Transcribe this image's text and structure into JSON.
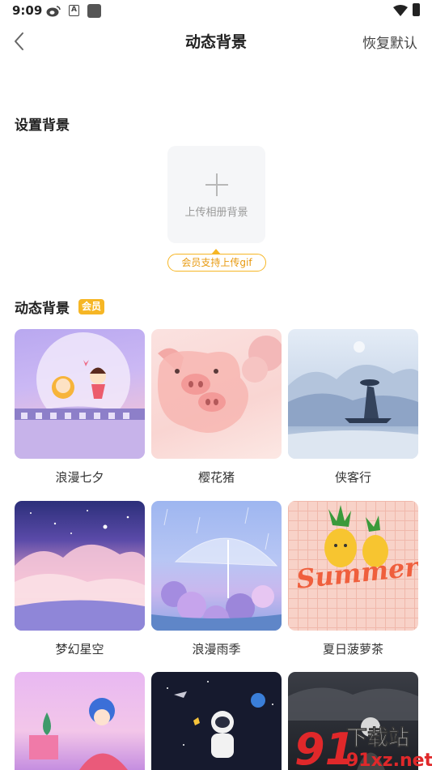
{
  "status_bar": {
    "time": "9:09",
    "icons": [
      "weibo-icon",
      "a-icon",
      "square-icon",
      "wifi-icon",
      "battery-icon"
    ]
  },
  "header": {
    "title": "动态背景",
    "restore_label": "恢复默认",
    "back_icon": "chevron-left-icon"
  },
  "set_background": {
    "title": "设置背景",
    "upload_label": "上传相册背景",
    "gif_tip": "会员支持上传gif"
  },
  "dynamic_backgrounds": {
    "title": "动态背景",
    "vip_badge": "会员",
    "items": [
      {
        "label": "浪漫七夕"
      },
      {
        "label": "樱花猪"
      },
      {
        "label": "侠客行"
      },
      {
        "label": "梦幻星空"
      },
      {
        "label": "浪漫雨季"
      },
      {
        "label": "夏日菠萝茶"
      }
    ],
    "summer_art_text": "Summer"
  },
  "watermark": {
    "text_top": "下载站",
    "text_bottom": "91xz.net",
    "logo": "91"
  },
  "colors": {
    "accent": "#f6b625",
    "accent_text": "#e89a10",
    "text": "#222222"
  }
}
